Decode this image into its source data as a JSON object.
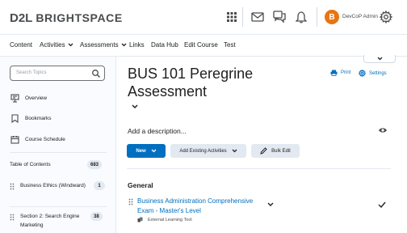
{
  "header": {
    "logo_d2l": "D2L",
    "logo_brightspace": "BRIGHTSPACE",
    "icons": [
      "apps-grid-icon",
      "mail-icon",
      "chat-icon",
      "bell-icon",
      "gear-icon"
    ],
    "avatar_initial": "B",
    "username": "DevCoP Admin"
  },
  "nav": {
    "items": [
      {
        "label": "Content"
      },
      {
        "label": "Activities",
        "dropdown": true
      },
      {
        "label": "Assessments",
        "dropdown": true
      },
      {
        "label": "Links"
      },
      {
        "label": "Data Hub"
      },
      {
        "label": "Edit Course"
      },
      {
        "label": "Test"
      }
    ]
  },
  "sidebar": {
    "search_placeholder": "Search Topics",
    "items": [
      {
        "label": "Overview",
        "icon": "overview-icon"
      },
      {
        "label": "Bookmarks",
        "icon": "bookmark-icon"
      },
      {
        "label": "Course Schedule",
        "icon": "calendar-icon"
      }
    ],
    "toc_label": "Table of Contents",
    "toc_count": "683",
    "modules": [
      {
        "title": "Business Ethics (Windward)",
        "count": "1"
      },
      {
        "title": "Section 2: Search Engine Marketing",
        "count": "38"
      }
    ]
  },
  "main": {
    "title": "BUS 101 Peregrine Assessment",
    "print_label": "Print",
    "settings_label": "Settings",
    "description_placeholder": "Add a description...",
    "new_button": "New",
    "add_existing_button": "Add Existing Activities",
    "bulk_edit_button": "Bulk Edit",
    "section_title": "General",
    "topic": {
      "title": "Business Administration Comprehensive Exam - Master's Level",
      "type": "External Learning Tool"
    }
  },
  "colors": {
    "accent": "#006fbf",
    "avatar": "#e87511",
    "text": "#202122",
    "divider": "#e3e9f1"
  }
}
